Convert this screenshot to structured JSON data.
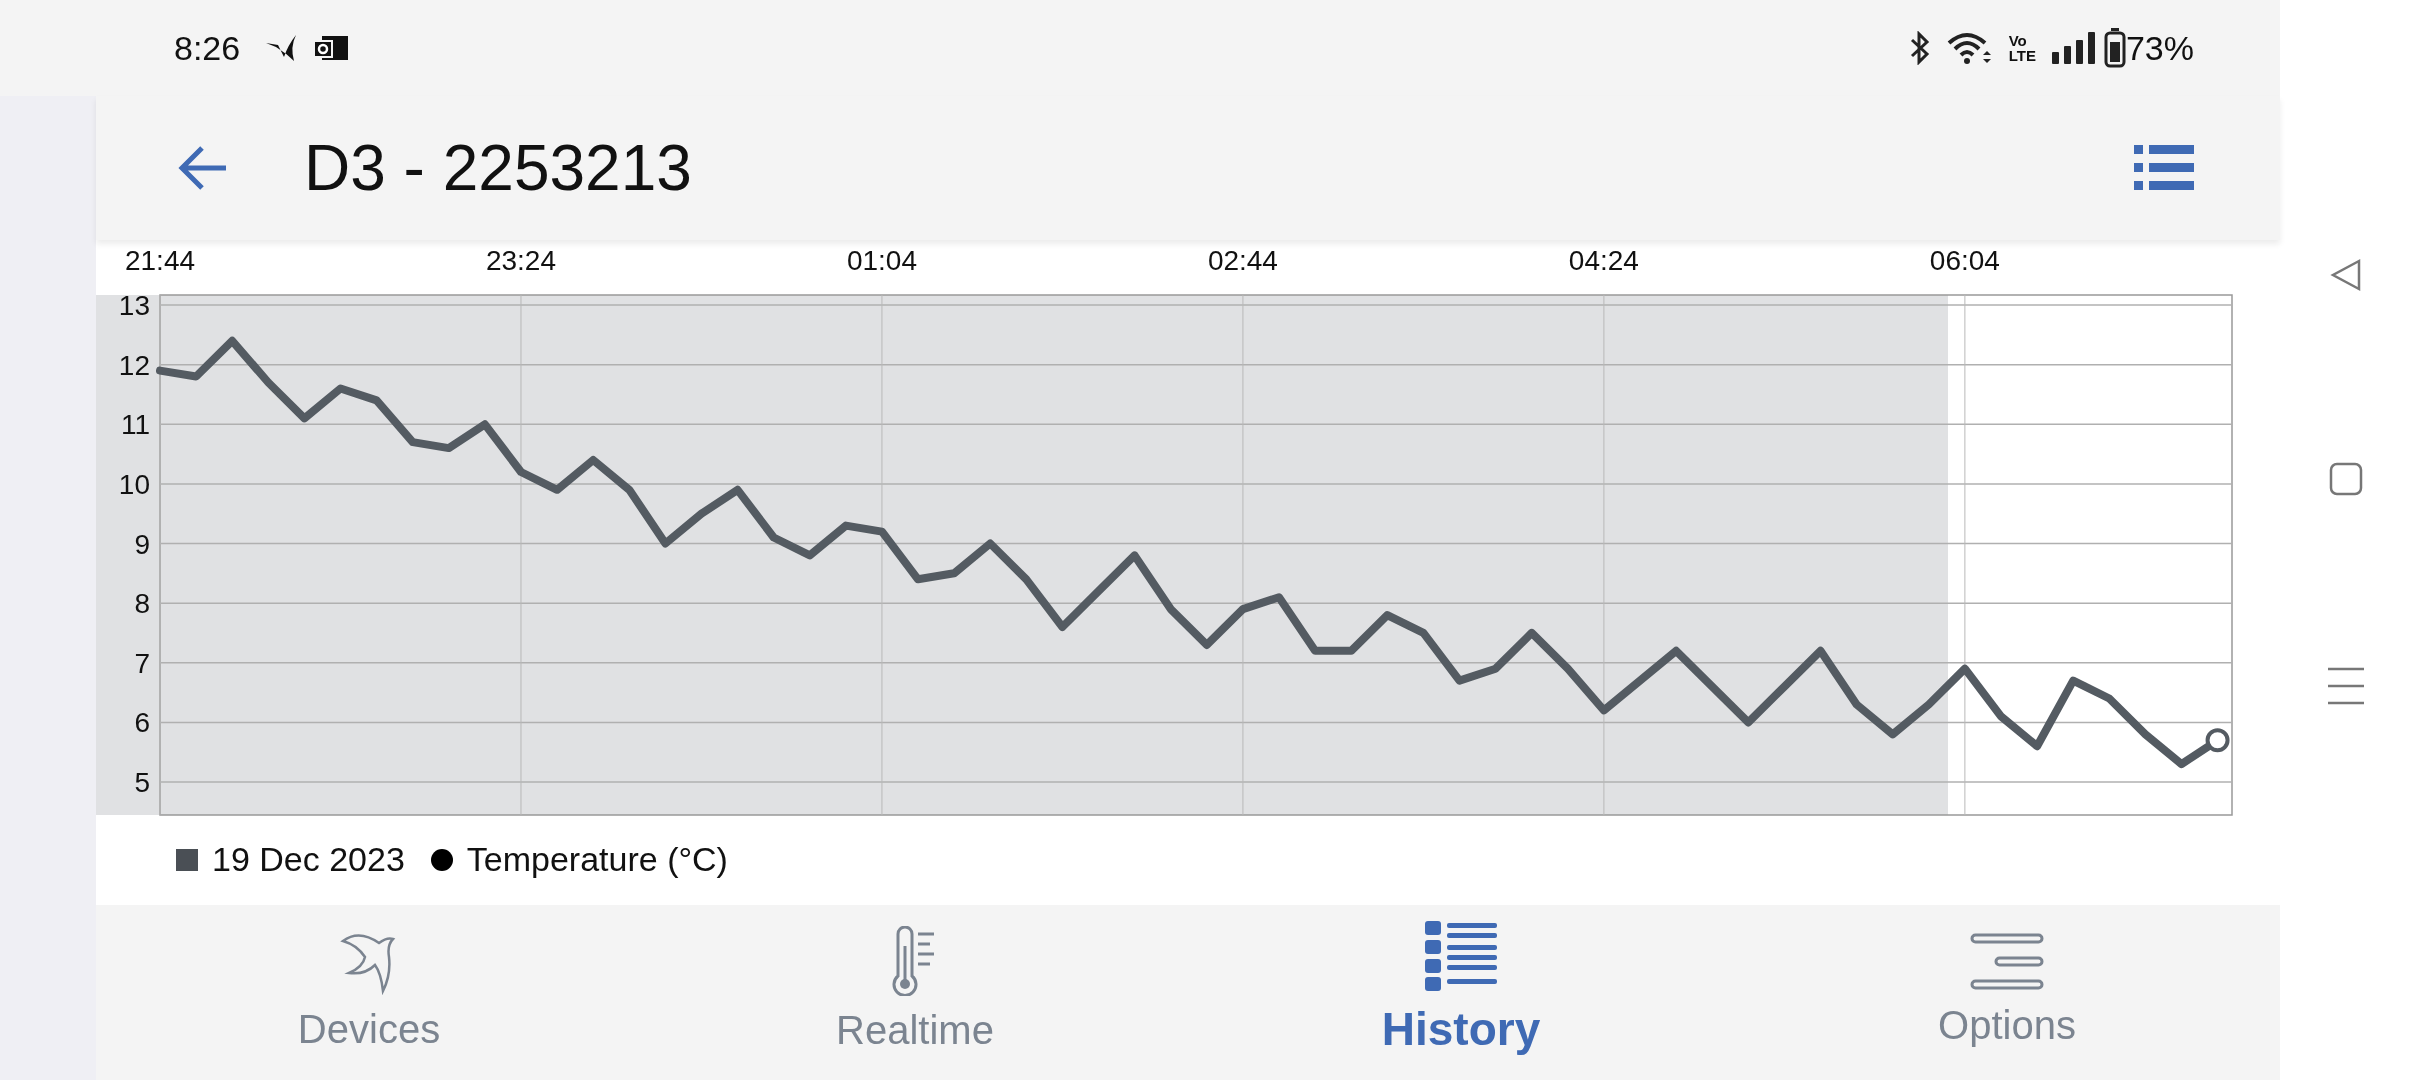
{
  "status_bar": {
    "time": "8:26",
    "network_label": [
      "Vo",
      "LTE"
    ],
    "battery": "73%"
  },
  "header": {
    "title": "D3 - 2253213"
  },
  "chart": {
    "chart_data": {
      "type": "line",
      "ylim": [
        5,
        13
      ],
      "categories": [
        "21:44",
        null,
        null,
        null,
        null,
        null,
        null,
        null,
        null,
        null,
        "23:24",
        null,
        null,
        null,
        null,
        null,
        null,
        null,
        null,
        null,
        "01:04",
        null,
        null,
        null,
        null,
        null,
        null,
        null,
        null,
        null,
        "02:44",
        null,
        null,
        null,
        null,
        null,
        null,
        null,
        null,
        null,
        "04:24",
        null,
        null,
        null,
        null,
        null,
        null,
        null,
        null,
        null,
        "06:04",
        null,
        null,
        null,
        null,
        null,
        null,
        null
      ],
      "yticks": [
        5,
        6,
        7,
        8,
        9,
        10,
        11,
        12,
        13
      ],
      "series": [
        {
          "name": "Temperature (°C)",
          "color": "#545b62",
          "values": [
            11.9,
            11.8,
            12.4,
            11.7,
            11.1,
            11.6,
            11.4,
            10.7,
            10.6,
            11.0,
            10.2,
            9.9,
            10.4,
            9.9,
            9.0,
            9.5,
            9.9,
            9.1,
            8.8,
            9.3,
            9.2,
            8.4,
            8.5,
            9.0,
            8.4,
            7.6,
            8.2,
            8.8,
            7.9,
            7.3,
            7.9,
            8.1,
            7.2,
            7.2,
            7.8,
            7.5,
            6.7,
            6.9,
            7.5,
            6.9,
            6.2,
            6.7,
            7.2,
            6.6,
            6.0,
            6.6,
            7.2,
            6.3,
            5.8,
            6.3,
            6.9,
            6.1,
            5.6,
            6.7,
            6.4,
            5.8,
            5.3,
            5.7
          ]
        }
      ],
      "grid": true
    },
    "legend": [
      {
        "label": "19 Dec 2023"
      }
    ]
  },
  "tabs": [
    {
      "label": "Devices",
      "selected": false
    },
    {
      "label": "Realtime",
      "selected": false
    },
    {
      "label": "History",
      "selected": true
    },
    {
      "label": "Options",
      "selected": false
    }
  ]
}
